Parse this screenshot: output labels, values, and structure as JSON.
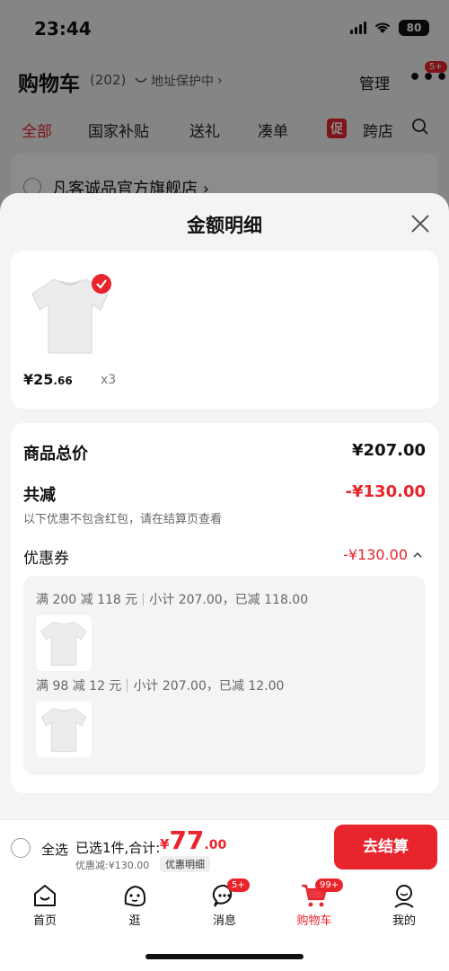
{
  "status_bar": {
    "time": "23:44",
    "battery": "80"
  },
  "header": {
    "title": "购物车",
    "count": "(202)",
    "address_protect": "地址保护中",
    "manage": "管理",
    "more_badge": "5+"
  },
  "tabs": [
    {
      "label": "全部",
      "active": true
    },
    {
      "label": "国家补贴"
    },
    {
      "label": "送礼"
    },
    {
      "label": "凑单"
    },
    {
      "label": "跨店",
      "tag": "促"
    }
  ],
  "store": {
    "name": "凡客诚品官方旗舰店 ›"
  },
  "sheet": {
    "title": "金额明细"
  },
  "product": {
    "price_int": "¥25",
    "price_dec": ".66",
    "qty": "x3"
  },
  "summary": {
    "total_label": "商品总价",
    "total_value": "¥207.00",
    "discount_label": "共减",
    "discount_value": "-¥130.00",
    "note": "以下优惠不包含红包，请在结算页查看",
    "coupon_label": "优惠券",
    "coupon_value": "-¥130.00",
    "deals": [
      {
        "rule": "满 200 减 118 元",
        "detail": "小计 207.00，已减 118.00"
      },
      {
        "rule": "满 98 减 12 元",
        "detail": "小计 207.00，已减 12.00"
      }
    ]
  },
  "checkout": {
    "select_all": "全选",
    "selected": "已选1件,合计:",
    "yen": "¥",
    "total_int": "77",
    "total_dec": ".00",
    "discount_text": "优惠减:¥130.00",
    "detail_chip": "优惠明细",
    "button": "去结算"
  },
  "nav": {
    "items": [
      {
        "label": "首页",
        "icon": "home-icon"
      },
      {
        "label": "逛",
        "icon": "browse-icon"
      },
      {
        "label": "消息",
        "icon": "message-icon",
        "badge": "5+"
      },
      {
        "label": "购物车",
        "icon": "cart-icon",
        "badge": "99+",
        "active": true
      },
      {
        "label": "我的",
        "icon": "profile-icon"
      }
    ]
  },
  "colors": {
    "accent": "#e8242c",
    "sheet_bg": "#f4f4f4"
  }
}
